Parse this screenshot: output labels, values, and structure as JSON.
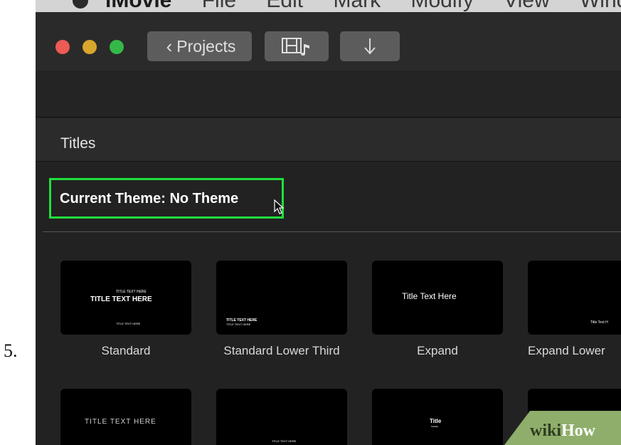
{
  "step_number": "5.",
  "menubar": {
    "app_name": "iMovie",
    "items": [
      "File",
      "Edit",
      "Mark",
      "Modify",
      "View",
      "Window"
    ]
  },
  "window": {
    "traffic_lights": {
      "close": "#ec5b56",
      "minimize": "#d9a62e",
      "zoom": "#35b848"
    },
    "toolbar": {
      "projects_label": "Projects",
      "media_icon": "film-music-icon",
      "import_icon": "down-arrow-icon"
    }
  },
  "browser": {
    "section_title": "Titles",
    "current_theme": "Current Theme: No Theme",
    "highlight_color": "#1fe03c",
    "tiles": [
      {
        "caption": "Standard",
        "preview_lines": [
          "TITLE TEXT HERE",
          "TITLE TEXT HERE",
          "TITLE TEXT HERE"
        ]
      },
      {
        "caption": "Standard Lower Third",
        "preview_lines": [
          "TITLE TEXT HERE",
          "TITLE TEXT HERE"
        ]
      },
      {
        "caption": "Expand",
        "preview_lines": [
          "Title Text Here"
        ]
      },
      {
        "caption": "Expand Lower",
        "preview_lines": [
          "Title Text H"
        ]
      }
    ],
    "row2_previews": [
      "TITLE TEXT HERE",
      "TITLE TEXT HERE",
      "Title",
      "Subtitle"
    ]
  },
  "watermark": {
    "wiki": "wiki",
    "how": "How"
  }
}
